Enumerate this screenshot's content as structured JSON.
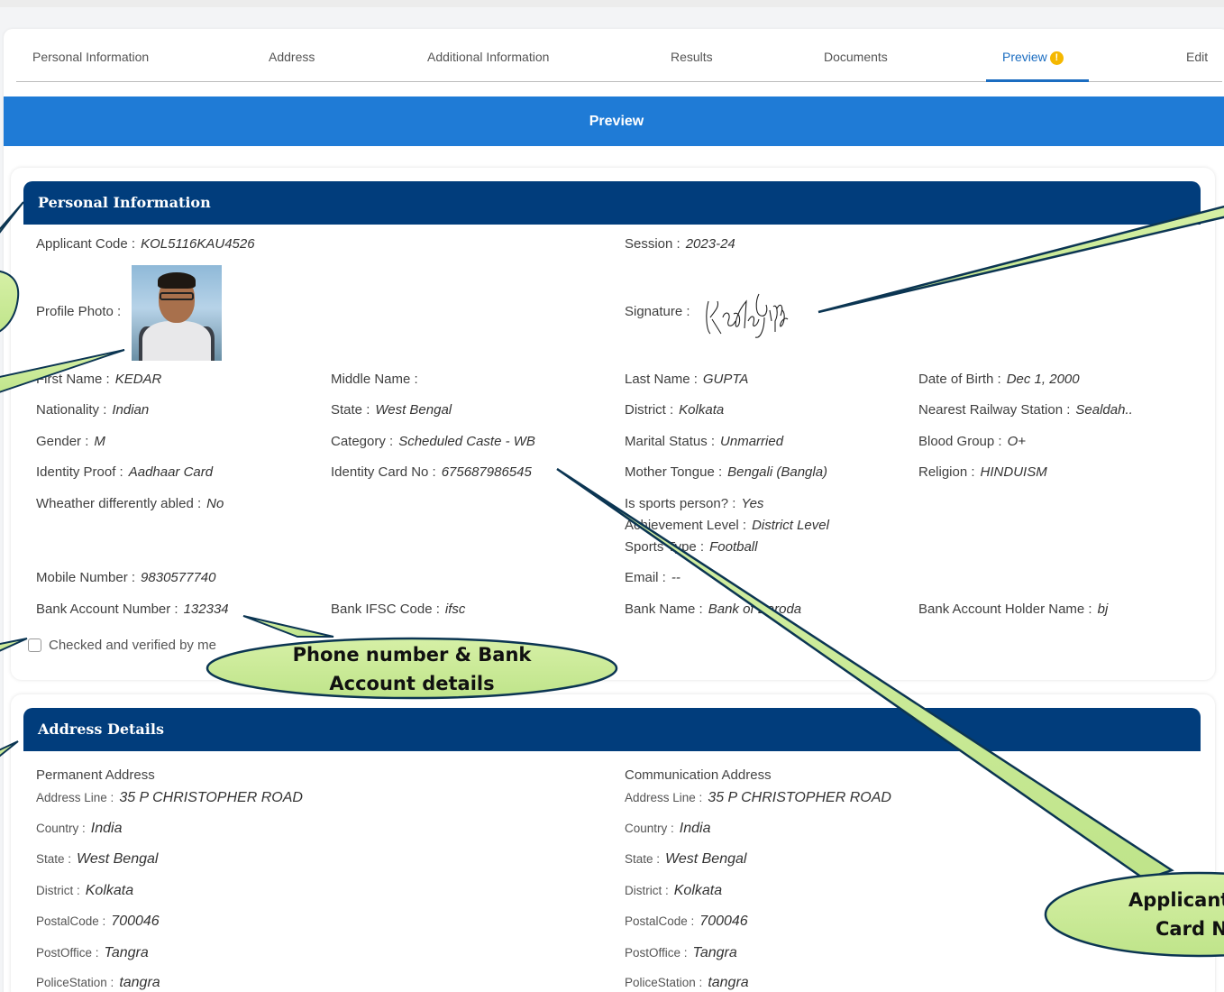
{
  "tabs": [
    {
      "label": "Personal Information"
    },
    {
      "label": "Address"
    },
    {
      "label": "Additional Information"
    },
    {
      "label": "Results"
    },
    {
      "label": "Documents"
    },
    {
      "label": "Preview"
    },
    {
      "label": "Edit"
    }
  ],
  "tab_warning_glyph": "!",
  "preview_bar": "Preview",
  "personal": {
    "header": "Personal Information",
    "applicant_code_label": "Applicant Code :",
    "applicant_code": "KOL5116KAU4526",
    "session_label": "Session :",
    "session": "2023-24",
    "profile_photo_label": "Profile Photo :",
    "signature_label": "Signature :",
    "first_name_label": "First Name :",
    "first_name": "KEDAR",
    "middle_name_label": "Middle Name :",
    "middle_name": "",
    "last_name_label": "Last Name :",
    "last_name": "GUPTA",
    "dob_label": "Date of Birth :",
    "dob": "Dec 1, 2000",
    "nationality_label": "Nationality :",
    "nationality": "Indian",
    "state_label": "State :",
    "state": "West Bengal",
    "district_label": "District :",
    "district": "Kolkata",
    "railway_label": "Nearest Railway Station :",
    "railway": "Sealdah..",
    "gender_label": "Gender :",
    "gender": "M",
    "category_label": "Category :",
    "category": "Scheduled Caste - WB",
    "marital_label": "Marital Status :",
    "marital": "Unmarried",
    "blood_label": "Blood Group :",
    "blood": "O+",
    "id_proof_label": "Identity Proof :",
    "id_proof": "Aadhaar Card",
    "id_no_label": "Identity Card No :",
    "id_no": "675687986545",
    "mother_tongue_label": "Mother Tongue :",
    "mother_tongue": "Bengali (Bangla)",
    "religion_label": "Religion :",
    "religion": "HINDUISM",
    "abled_label": "Wheather differently abled :",
    "abled": "No",
    "sports_label": "Is sports person? :",
    "sports": "Yes",
    "achievement_label": "Achievement Level :",
    "achievement": "District Level",
    "sports_type_label": "Sports Type :",
    "sports_type": "Football",
    "mobile_label": "Mobile Number :",
    "mobile": "9830577740",
    "email_label": "Email :",
    "email": "--",
    "bank_acc_label": "Bank Account Number :",
    "bank_acc": "132334",
    "ifsc_label": "Bank IFSC Code :",
    "ifsc": "ifsc",
    "bank_name_label": "Bank Name :",
    "bank_name": "Bank of Baroda",
    "holder_label": "Bank Account Holder Name :",
    "holder": "bj",
    "verify_label": "Checked and verified by me"
  },
  "address": {
    "header": "Address Details",
    "permanent": {
      "title": "Permanent Address",
      "address_line_label": "Address Line :",
      "address_line": "35 P CHRISTOPHER ROAD",
      "country_label": "Country :",
      "country": "India",
      "state_label": "State :",
      "state": "West Bengal",
      "district_label": "District :",
      "district": "Kolkata",
      "postal_label": "PostalCode :",
      "postal": "700046",
      "postoffice_label": "PostOffice :",
      "postoffice": "Tangra",
      "police_label": "PoliceStation :",
      "police": "tangra"
    },
    "communication": {
      "title": "Communication Address",
      "address_line_label": "Address Line :",
      "address_line": "35 P CHRISTOPHER ROAD",
      "country_label": "Country :",
      "country": "India",
      "state_label": "State :",
      "state": "West Bengal",
      "district_label": "District :",
      "district": "Kolkata",
      "postal_label": "PostalCode :",
      "postal": "700046",
      "postoffice_label": "PostOffice :",
      "postoffice": "Tangra",
      "police_label": "PoliceStation :",
      "police": "tangra"
    }
  },
  "callouts": {
    "bank_line1": "Phone number & Bank",
    "bank_line2": "Account details",
    "idcard_line1": "Applicant",
    "idcard_line2": "Card N"
  },
  "colors": {
    "accent_blue": "#1f7bd6",
    "header_navy": "#013d7c",
    "active_tab": "#1b6dc1",
    "callout_green": "#c8ea8e",
    "warning": "#f5b800"
  },
  "signature_text": "Kedar Gupta"
}
